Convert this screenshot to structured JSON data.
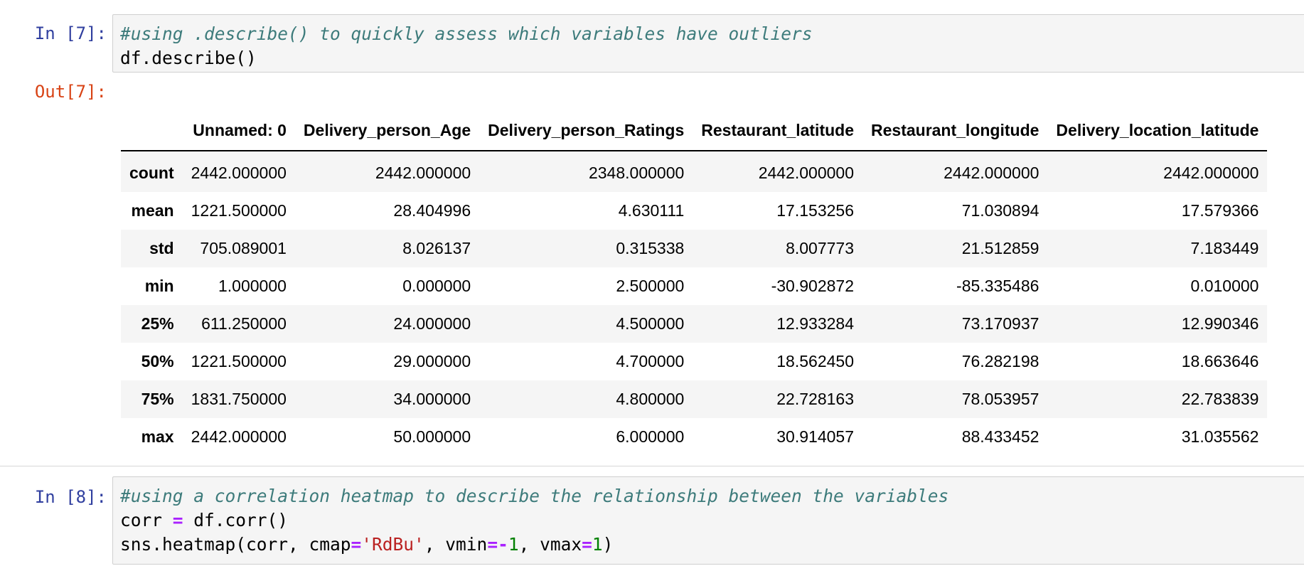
{
  "cell7": {
    "in_prompt": "In [7]:",
    "code_comment": "#using .describe() to quickly assess which variables have outliers",
    "code_line2": "df.describe()",
    "out_prompt": "Out[7]:"
  },
  "table": {
    "columns": [
      "Unnamed: 0",
      "Delivery_person_Age",
      "Delivery_person_Ratings",
      "Restaurant_latitude",
      "Restaurant_longitude",
      "Delivery_location_latitude"
    ],
    "rows": [
      {
        "label": "count",
        "values": [
          "2442.000000",
          "2442.000000",
          "2348.000000",
          "2442.000000",
          "2442.000000",
          "2442.000000"
        ]
      },
      {
        "label": "mean",
        "values": [
          "1221.500000",
          "28.404996",
          "4.630111",
          "17.153256",
          "71.030894",
          "17.579366"
        ]
      },
      {
        "label": "std",
        "values": [
          "705.089001",
          "8.026137",
          "0.315338",
          "8.007773",
          "21.512859",
          "7.183449"
        ]
      },
      {
        "label": "min",
        "values": [
          "1.000000",
          "0.000000",
          "2.500000",
          "-30.902872",
          "-85.335486",
          "0.010000"
        ]
      },
      {
        "label": "25%",
        "values": [
          "611.250000",
          "24.000000",
          "4.500000",
          "12.933284",
          "73.170937",
          "12.990346"
        ]
      },
      {
        "label": "50%",
        "values": [
          "1221.500000",
          "29.000000",
          "4.700000",
          "18.562450",
          "76.282198",
          "18.663646"
        ]
      },
      {
        "label": "75%",
        "values": [
          "1831.750000",
          "34.000000",
          "4.800000",
          "22.728163",
          "78.053957",
          "22.783839"
        ]
      },
      {
        "label": "max",
        "values": [
          "2442.000000",
          "50.000000",
          "6.000000",
          "30.914057",
          "88.433452",
          "31.035562"
        ]
      }
    ]
  },
  "cell8": {
    "in_prompt": "In [8]:",
    "code_comment": "#using a correlation heatmap to describe the relationship between the variables",
    "line2": {
      "a": "corr ",
      "op": "=",
      "b": " df.corr()"
    },
    "line3": {
      "a": "sns.heatmap(corr, cmap",
      "op1": "=",
      "str": "'RdBu'",
      "b": ", vmin",
      "op2": "=-",
      "n1": "1",
      "c": ", vmax",
      "op3": "=",
      "n2": "1",
      "d": ")"
    }
  },
  "colors": {
    "prompt_in": "#303f9f",
    "prompt_out": "#d84315",
    "comment": "#3d7b7b",
    "operator": "#aa22ff",
    "string": "#ba2121",
    "number": "#008000"
  }
}
